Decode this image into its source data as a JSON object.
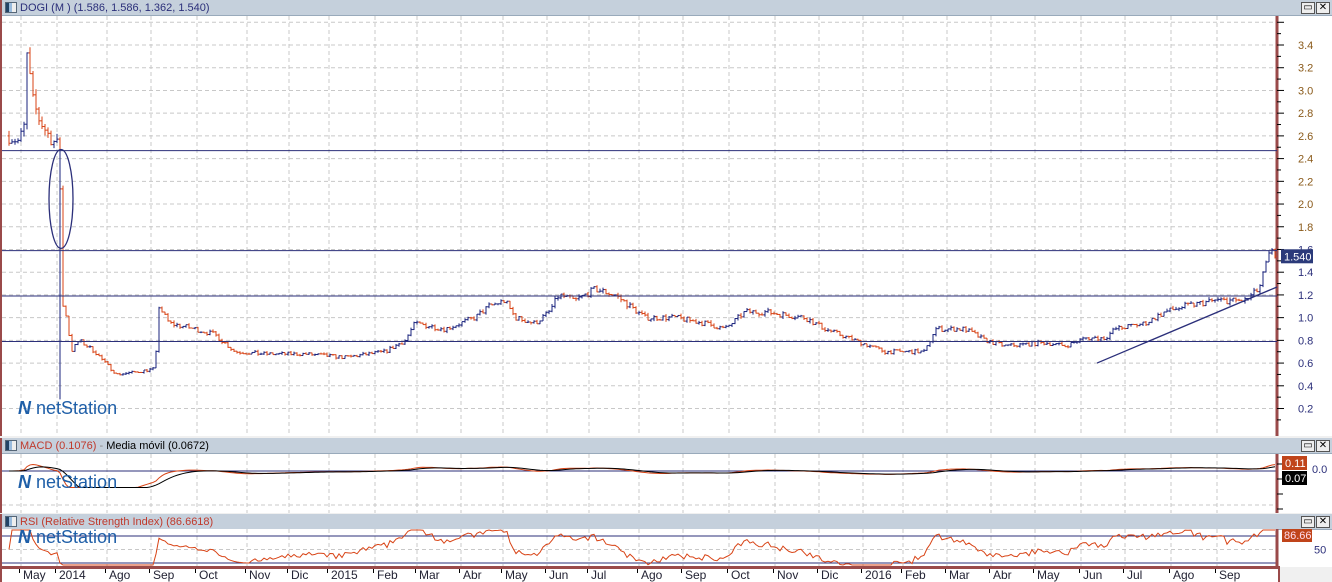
{
  "main": {
    "title": "DOGI (M ) (1.586, 1.586, 1.362, 1.540)",
    "last_price": "1.540",
    "logo": "netStation",
    "y_labels": [
      "3.4",
      "3.2",
      "3.0",
      "2.8",
      "2.6",
      "2.4",
      "2.2",
      "2.0",
      "1.8",
      "1.6",
      "1.4",
      "1.2",
      "1.0",
      "0.8",
      "0.6",
      "0.4",
      "0.2"
    ]
  },
  "macd": {
    "title": "MACD (0.1076)",
    "sep": " - ",
    "ma_title": "Media móvil (0.0672)",
    "macd_value": "0.11",
    "ma_value": "0.07",
    "zero_label": "0.0",
    "logo": "netStation"
  },
  "rsi": {
    "title": "RSI (Relative Strength Index) (86.6618)",
    "value": "86.66",
    "mid_label": "50",
    "logo": "netStation"
  },
  "buttons": {
    "maximize": "▭",
    "close": "✕"
  },
  "x_axis": {
    "labels": [
      "May",
      "2014",
      "Ago",
      "Sep",
      "Oct",
      "Nov",
      "Dic",
      "2015",
      "Feb",
      "Mar",
      "Abr",
      "May",
      "Jun",
      "Jul",
      "Ago",
      "Sep",
      "Oct",
      "Nov",
      "Dic",
      "2016",
      "Feb",
      "Mar",
      "Abr",
      "May",
      "Jun",
      "Jul",
      "Ago",
      "Sep"
    ],
    "tick_days": [
      8,
      26,
      51,
      73,
      96,
      121,
      142,
      162,
      185,
      206,
      228,
      249,
      271,
      292,
      317,
      339,
      362,
      385,
      407,
      429,
      449,
      471,
      493,
      515,
      538,
      560,
      583,
      606
    ]
  },
  "chart_data": {
    "type": "ohlc",
    "unit": "trading days",
    "ylim": [
      0,
      3.6
    ],
    "close_points": [
      [
        2,
        2.6
      ],
      [
        7,
        2.55
      ],
      [
        10,
        2.7
      ],
      [
        11,
        3.3
      ],
      [
        14,
        2.9
      ],
      [
        17,
        2.75
      ],
      [
        22,
        2.6
      ],
      [
        27,
        2.5
      ],
      [
        29,
        1.1
      ],
      [
        31,
        1.0
      ],
      [
        33,
        0.7
      ],
      [
        37,
        0.8
      ],
      [
        45,
        0.7
      ],
      [
        50,
        0.6
      ],
      [
        56,
        0.5
      ],
      [
        65,
        0.52
      ],
      [
        75,
        0.55
      ],
      [
        77,
        1.1
      ],
      [
        82,
        0.95
      ],
      [
        95,
        0.9
      ],
      [
        105,
        0.85
      ],
      [
        115,
        0.7
      ],
      [
        130,
        0.68
      ],
      [
        150,
        0.68
      ],
      [
        170,
        0.65
      ],
      [
        190,
        0.7
      ],
      [
        200,
        0.8
      ],
      [
        205,
        0.95
      ],
      [
        220,
        0.9
      ],
      [
        235,
        1.0
      ],
      [
        242,
        1.1
      ],
      [
        250,
        1.15
      ],
      [
        255,
        1.0
      ],
      [
        265,
        0.95
      ],
      [
        272,
        1.05
      ],
      [
        277,
        1.2
      ],
      [
        285,
        1.15
      ],
      [
        295,
        1.25
      ],
      [
        305,
        1.2
      ],
      [
        320,
        1.0
      ],
      [
        335,
        1.0
      ],
      [
        350,
        0.95
      ],
      [
        360,
        0.9
      ],
      [
        370,
        1.05
      ],
      [
        380,
        1.05
      ],
      [
        400,
        1.0
      ],
      [
        410,
        0.9
      ],
      [
        425,
        0.8
      ],
      [
        440,
        0.7
      ],
      [
        460,
        0.7
      ],
      [
        465,
        0.9
      ],
      [
        480,
        0.9
      ],
      [
        490,
        0.8
      ],
      [
        500,
        0.75
      ],
      [
        520,
        0.78
      ],
      [
        530,
        0.75
      ],
      [
        540,
        0.82
      ],
      [
        550,
        0.82
      ],
      [
        555,
        0.9
      ],
      [
        570,
        0.95
      ],
      [
        580,
        1.05
      ],
      [
        590,
        1.1
      ],
      [
        605,
        1.15
      ],
      [
        620,
        1.15
      ],
      [
        627,
        1.25
      ],
      [
        631,
        1.5
      ],
      [
        633,
        1.58
      ],
      [
        635,
        1.54
      ]
    ],
    "horizontal_lines": [
      2.47,
      1.59,
      1.19,
      0.79
    ],
    "trendline": [
      [
        546,
        0.6
      ],
      [
        636,
        1.27
      ]
    ],
    "ellipse": {
      "day": 28,
      "top": 2.48,
      "bottom": 1.61
    },
    "rsi_levels": [
      70,
      50,
      30
    ],
    "colors": {
      "up": "#1a237e",
      "down": "#d84315",
      "macd": "#d84315",
      "signal": "#000000",
      "line": "#2b2f7a"
    }
  }
}
